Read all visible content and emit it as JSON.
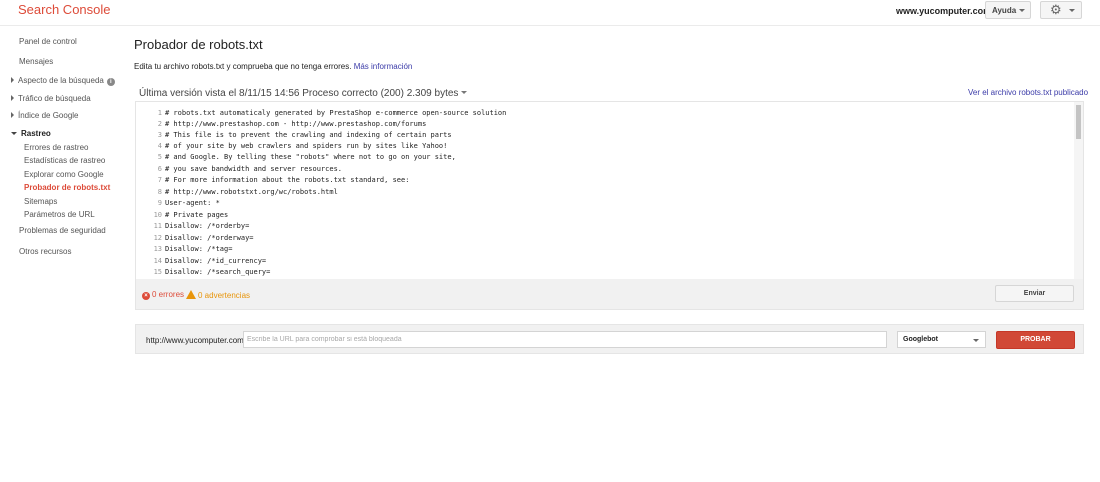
{
  "header": {
    "brand": "Search Console",
    "site": "www.yucomputer.com",
    "help_label": "Ayuda",
    "settings_icon": "gear-icon"
  },
  "sidebar": {
    "items": [
      {
        "label": "Panel de control"
      },
      {
        "label": "Mensajes"
      },
      {
        "label": "Aspecto de la búsqueda"
      },
      {
        "label": "Tráfico de búsqueda"
      },
      {
        "label": "Índice de Google"
      },
      {
        "label": "Rastreo"
      },
      {
        "label": "Errores de rastreo"
      },
      {
        "label": "Estadísticas de rastreo"
      },
      {
        "label": "Explorar como Google"
      },
      {
        "label": "Probador de robots.txt"
      },
      {
        "label": "Sitemaps"
      },
      {
        "label": "Parámetros de URL"
      },
      {
        "label": "Problemas de seguridad"
      },
      {
        "label": "Otros recursos"
      }
    ],
    "active_color": "#dd4b39"
  },
  "main": {
    "title": "Probador de robots.txt",
    "description": "Edita tu archivo robots.txt y comprueba que no tenga errores.",
    "more_info": "Más información",
    "version_text": "Última versión vista el 8/11/15 14:56 Proceso correcto (200) 2.309 bytes",
    "view_published": "Ver el archivo robots.txt publicado"
  },
  "editor": {
    "lines": [
      {
        "n": "1",
        "text": "# robots.txt automaticaly generated by PrestaShop e-commerce open-source solution"
      },
      {
        "n": "2",
        "text": "# http://www.prestashop.com - http://www.prestashop.com/forums"
      },
      {
        "n": "3",
        "text": "# This file is to prevent the crawling and indexing of certain parts"
      },
      {
        "n": "4",
        "text": "# of your site by web crawlers and spiders run by sites like Yahoo!"
      },
      {
        "n": "5",
        "text": "# and Google. By telling these \"robots\" where not to go on your site,"
      },
      {
        "n": "6",
        "text": "# you save bandwidth and server resources."
      },
      {
        "n": "7",
        "text": "# For more information about the robots.txt standard, see:"
      },
      {
        "n": "8",
        "text": "# http://www.robotstxt.org/wc/robots.html"
      },
      {
        "n": "9",
        "text": "User-agent: *"
      },
      {
        "n": "10",
        "text": "# Private pages"
      },
      {
        "n": "11",
        "text": "Disallow: /*orderby="
      },
      {
        "n": "12",
        "text": "Disallow: /*orderway="
      },
      {
        "n": "13",
        "text": "Disallow: /*tag="
      },
      {
        "n": "14",
        "text": "Disallow: /*id_currency="
      },
      {
        "n": "15",
        "text": "Disallow: /*search_query="
      }
    ],
    "errors": "0 errores",
    "warnings": "0 advertencias",
    "send_label": "Enviar"
  },
  "tester": {
    "prefix": "http://www.yucomputer.com/",
    "placeholder": "Escribe la URL para comprobar si está bloqueada",
    "bot": "Googlebot",
    "test_label": "PROBAR",
    "test_color": "#d14836"
  }
}
